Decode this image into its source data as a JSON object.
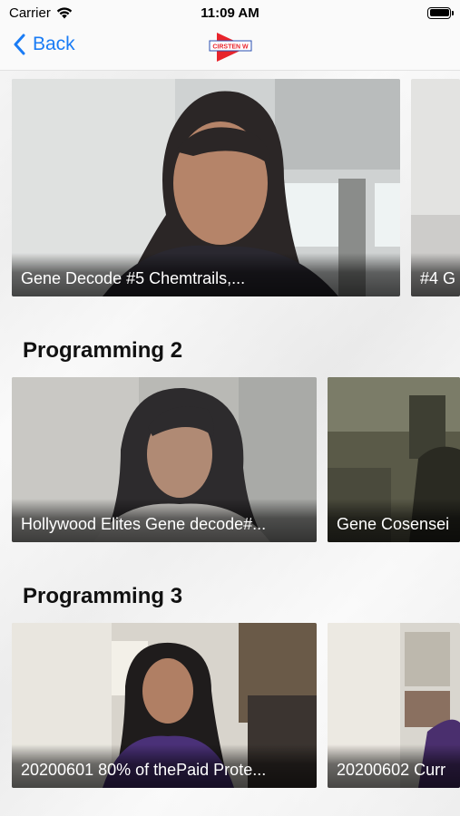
{
  "status_bar": {
    "carrier": "Carrier",
    "time": "11:09 AM"
  },
  "nav": {
    "back_label": "Back",
    "logo_text": "CIRSTEN W"
  },
  "featured_row": {
    "items": [
      {
        "title": "Gene Decode #5 Chemtrails,..."
      },
      {
        "title": "#4 G"
      }
    ]
  },
  "sections": [
    {
      "title": "Programming 2",
      "items": [
        {
          "title": "Hollywood Elites Gene decode#..."
        },
        {
          "title": "Gene Cosensei"
        }
      ]
    },
    {
      "title": "Programming 3",
      "items": [
        {
          "title": "20200601 80% of thePaid Prote..."
        },
        {
          "title": "20200602 Curr"
        }
      ]
    }
  ],
  "colors": {
    "accent": "#1a7cf5",
    "logo_red": "#e8242c"
  }
}
